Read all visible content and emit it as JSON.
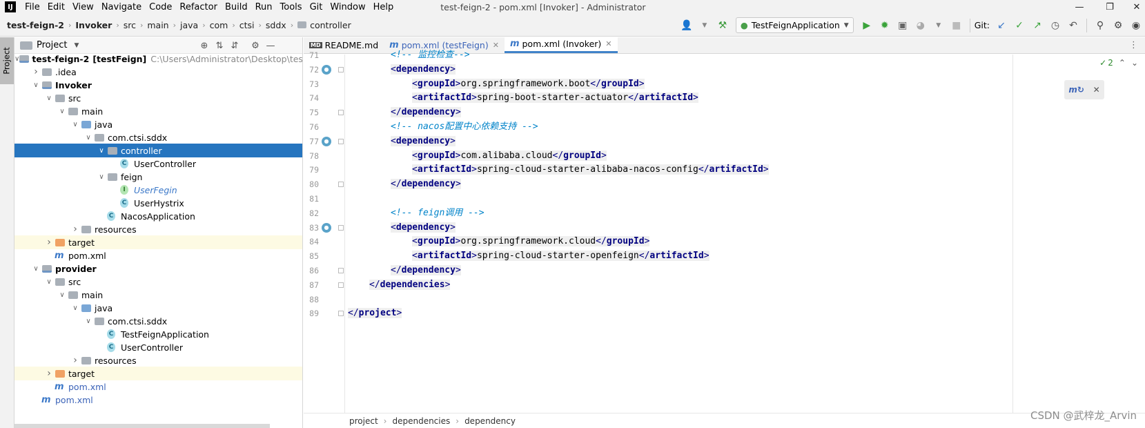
{
  "menu": {
    "logo": "IJ",
    "items": [
      "File",
      "Edit",
      "View",
      "Navigate",
      "Code",
      "Refactor",
      "Build",
      "Run",
      "Tools",
      "Git",
      "Window",
      "Help"
    ],
    "window_title": "test-feign-2 - pom.xml [Invoker] - Administrator"
  },
  "nav": {
    "crumbs": [
      "test-feign-2",
      "Invoker",
      "src",
      "main",
      "java",
      "com",
      "ctsi",
      "sddx",
      "controller"
    ],
    "run_config": "TestFeignApplication",
    "git_label": "Git:"
  },
  "strip": {
    "project_tab": "Project"
  },
  "project_panel": {
    "title": "Project",
    "tree": [
      {
        "label": "test-feign-2",
        "suffix": "[testFeign]",
        "path": "C:\\Users\\Administrator\\Desktop\\test-feig",
        "indent": 0,
        "arrow": "down",
        "icon": "modfolder",
        "bold": true
      },
      {
        "label": ".idea",
        "indent": 1,
        "arrow": "right",
        "icon": "folder"
      },
      {
        "label": "Invoker",
        "indent": 1,
        "arrow": "down",
        "icon": "modfolder",
        "bold": true
      },
      {
        "label": "src",
        "indent": 2,
        "arrow": "down",
        "icon": "folder"
      },
      {
        "label": "main",
        "indent": 3,
        "arrow": "down",
        "icon": "folder"
      },
      {
        "label": "java",
        "indent": 4,
        "arrow": "down",
        "icon": "folder-blue"
      },
      {
        "label": "com.ctsi.sddx",
        "indent": 5,
        "arrow": "down",
        "icon": "folder"
      },
      {
        "label": "controller",
        "indent": 6,
        "arrow": "down",
        "icon": "folder",
        "selected": true
      },
      {
        "label": "UserController",
        "indent": 7,
        "arrow": "",
        "icon": "class"
      },
      {
        "label": "feign",
        "indent": 6,
        "arrow": "down",
        "icon": "folder"
      },
      {
        "label": "UserFegin",
        "indent": 7,
        "arrow": "",
        "icon": "interface",
        "italic_blue": true
      },
      {
        "label": "UserHystrix",
        "indent": 7,
        "arrow": "",
        "icon": "class"
      },
      {
        "label": "NacosApplication",
        "indent": 6,
        "arrow": "",
        "icon": "class"
      },
      {
        "label": "resources",
        "indent": 4,
        "arrow": "right",
        "icon": "folder"
      },
      {
        "label": "target",
        "indent": 2,
        "arrow": "right",
        "icon": "folder-orange",
        "excluded": true
      },
      {
        "label": "pom.xml",
        "indent": 2,
        "arrow": "",
        "icon": "maven"
      },
      {
        "label": "provider",
        "indent": 1,
        "arrow": "down",
        "icon": "modfolder",
        "bold": true
      },
      {
        "label": "src",
        "indent": 2,
        "arrow": "down",
        "icon": "folder"
      },
      {
        "label": "main",
        "indent": 3,
        "arrow": "down",
        "icon": "folder"
      },
      {
        "label": "java",
        "indent": 4,
        "arrow": "down",
        "icon": "folder-blue"
      },
      {
        "label": "com.ctsi.sddx",
        "indent": 5,
        "arrow": "down",
        "icon": "folder"
      },
      {
        "label": "TestFeignApplication",
        "indent": 6,
        "arrow": "",
        "icon": "class"
      },
      {
        "label": "UserController",
        "indent": 6,
        "arrow": "",
        "icon": "class"
      },
      {
        "label": "resources",
        "indent": 4,
        "arrow": "right",
        "icon": "folder"
      },
      {
        "label": "target",
        "indent": 2,
        "arrow": "right",
        "icon": "folder-orange",
        "excluded": true
      },
      {
        "label": "pom.xml",
        "indent": 2,
        "arrow": "",
        "icon": "maven",
        "blue": true
      },
      {
        "label": "pom.xml",
        "indent": 1,
        "arrow": "",
        "icon": "maven",
        "blue": true
      }
    ]
  },
  "editor": {
    "tabs": [
      {
        "label": "README.md",
        "icon": "MD",
        "active": false,
        "blue": false
      },
      {
        "label": "pom.xml (testFeign)",
        "icon": "m",
        "active": false,
        "blue": true
      },
      {
        "label": "pom.xml (Invoker)",
        "icon": "m",
        "active": true,
        "blue": false
      }
    ],
    "lines": [
      {
        "n": "71",
        "indent": 2,
        "kind": "comment",
        "text": "<!-- 监控检查-->",
        "mark": false,
        "fold": false
      },
      {
        "n": "72",
        "indent": 2,
        "kind": "open",
        "tag": "dependency",
        "mark": true,
        "fold": true
      },
      {
        "n": "73",
        "indent": 3,
        "kind": "elem",
        "tag": "groupId",
        "text": "org.springframework.boot",
        "mark": false,
        "fold": false
      },
      {
        "n": "74",
        "indent": 3,
        "kind": "elem",
        "tag": "artifactId",
        "text": "spring-boot-starter-actuator",
        "mark": false,
        "fold": false
      },
      {
        "n": "75",
        "indent": 2,
        "kind": "close",
        "tag": "dependency",
        "mark": false,
        "fold": true
      },
      {
        "n": "76",
        "indent": 2,
        "kind": "comment",
        "text": "<!-- nacos配置中心依赖支持 -->",
        "mark": false,
        "fold": false
      },
      {
        "n": "77",
        "indent": 2,
        "kind": "open",
        "tag": "dependency",
        "mark": true,
        "fold": true
      },
      {
        "n": "78",
        "indent": 3,
        "kind": "elem",
        "tag": "groupId",
        "text": "com.alibaba.cloud",
        "mark": false,
        "fold": false
      },
      {
        "n": "79",
        "indent": 3,
        "kind": "elem",
        "tag": "artifactId",
        "text": "spring-cloud-starter-alibaba-nacos-config",
        "mark": false,
        "fold": false
      },
      {
        "n": "80",
        "indent": 2,
        "kind": "close",
        "tag": "dependency",
        "mark": false,
        "fold": true
      },
      {
        "n": "81",
        "indent": 0,
        "kind": "blank",
        "mark": false,
        "fold": false
      },
      {
        "n": "82",
        "indent": 2,
        "kind": "comment",
        "text": "<!-- feign调用 -->",
        "mark": false,
        "fold": false
      },
      {
        "n": "83",
        "indent": 2,
        "kind": "open",
        "tag": "dependency",
        "mark": true,
        "fold": true
      },
      {
        "n": "84",
        "indent": 3,
        "kind": "elem",
        "tag": "groupId",
        "text": "org.springframework.cloud",
        "mark": false,
        "fold": false
      },
      {
        "n": "85",
        "indent": 3,
        "kind": "elem",
        "tag": "artifactId",
        "text": "spring-cloud-starter-openfeign",
        "mark": false,
        "fold": false
      },
      {
        "n": "86",
        "indent": 2,
        "kind": "close",
        "tag": "dependency",
        "mark": false,
        "fold": true
      },
      {
        "n": "87",
        "indent": 1,
        "kind": "close",
        "tag": "dependencies",
        "mark": false,
        "fold": true
      },
      {
        "n": "88",
        "indent": 0,
        "kind": "blank",
        "mark": false,
        "fold": false
      },
      {
        "n": "89",
        "indent": 0,
        "kind": "close",
        "tag": "project",
        "mark": false,
        "fold": true
      }
    ],
    "inspection_count": "2",
    "breadcrumb": [
      "project",
      "dependencies",
      "dependency"
    ]
  },
  "watermark": "CSDN @武梓龙_Arvin"
}
